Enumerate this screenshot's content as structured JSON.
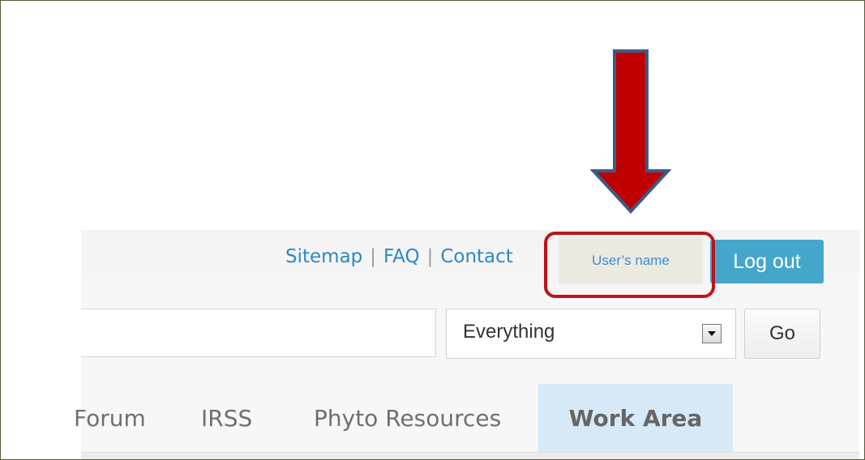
{
  "header": {
    "links": [
      {
        "label": "Sitemap"
      },
      {
        "label": "FAQ"
      },
      {
        "label": "Contact"
      }
    ],
    "separator": "|",
    "username": "User’s name",
    "logout_label": "Log out"
  },
  "search": {
    "value": "",
    "scope_selected": "Everything",
    "go_label": "Go"
  },
  "nav": {
    "items": [
      {
        "label": "Forum",
        "visible_label": "Forum"
      },
      {
        "label": "IRSS"
      },
      {
        "label": "Phyto Resources"
      },
      {
        "label": "Work Area",
        "active": true
      }
    ]
  },
  "annotation": {
    "arrow_color": "#c00000",
    "arrow_outline": "#3b5a8a",
    "box_color": "#c0121b"
  }
}
